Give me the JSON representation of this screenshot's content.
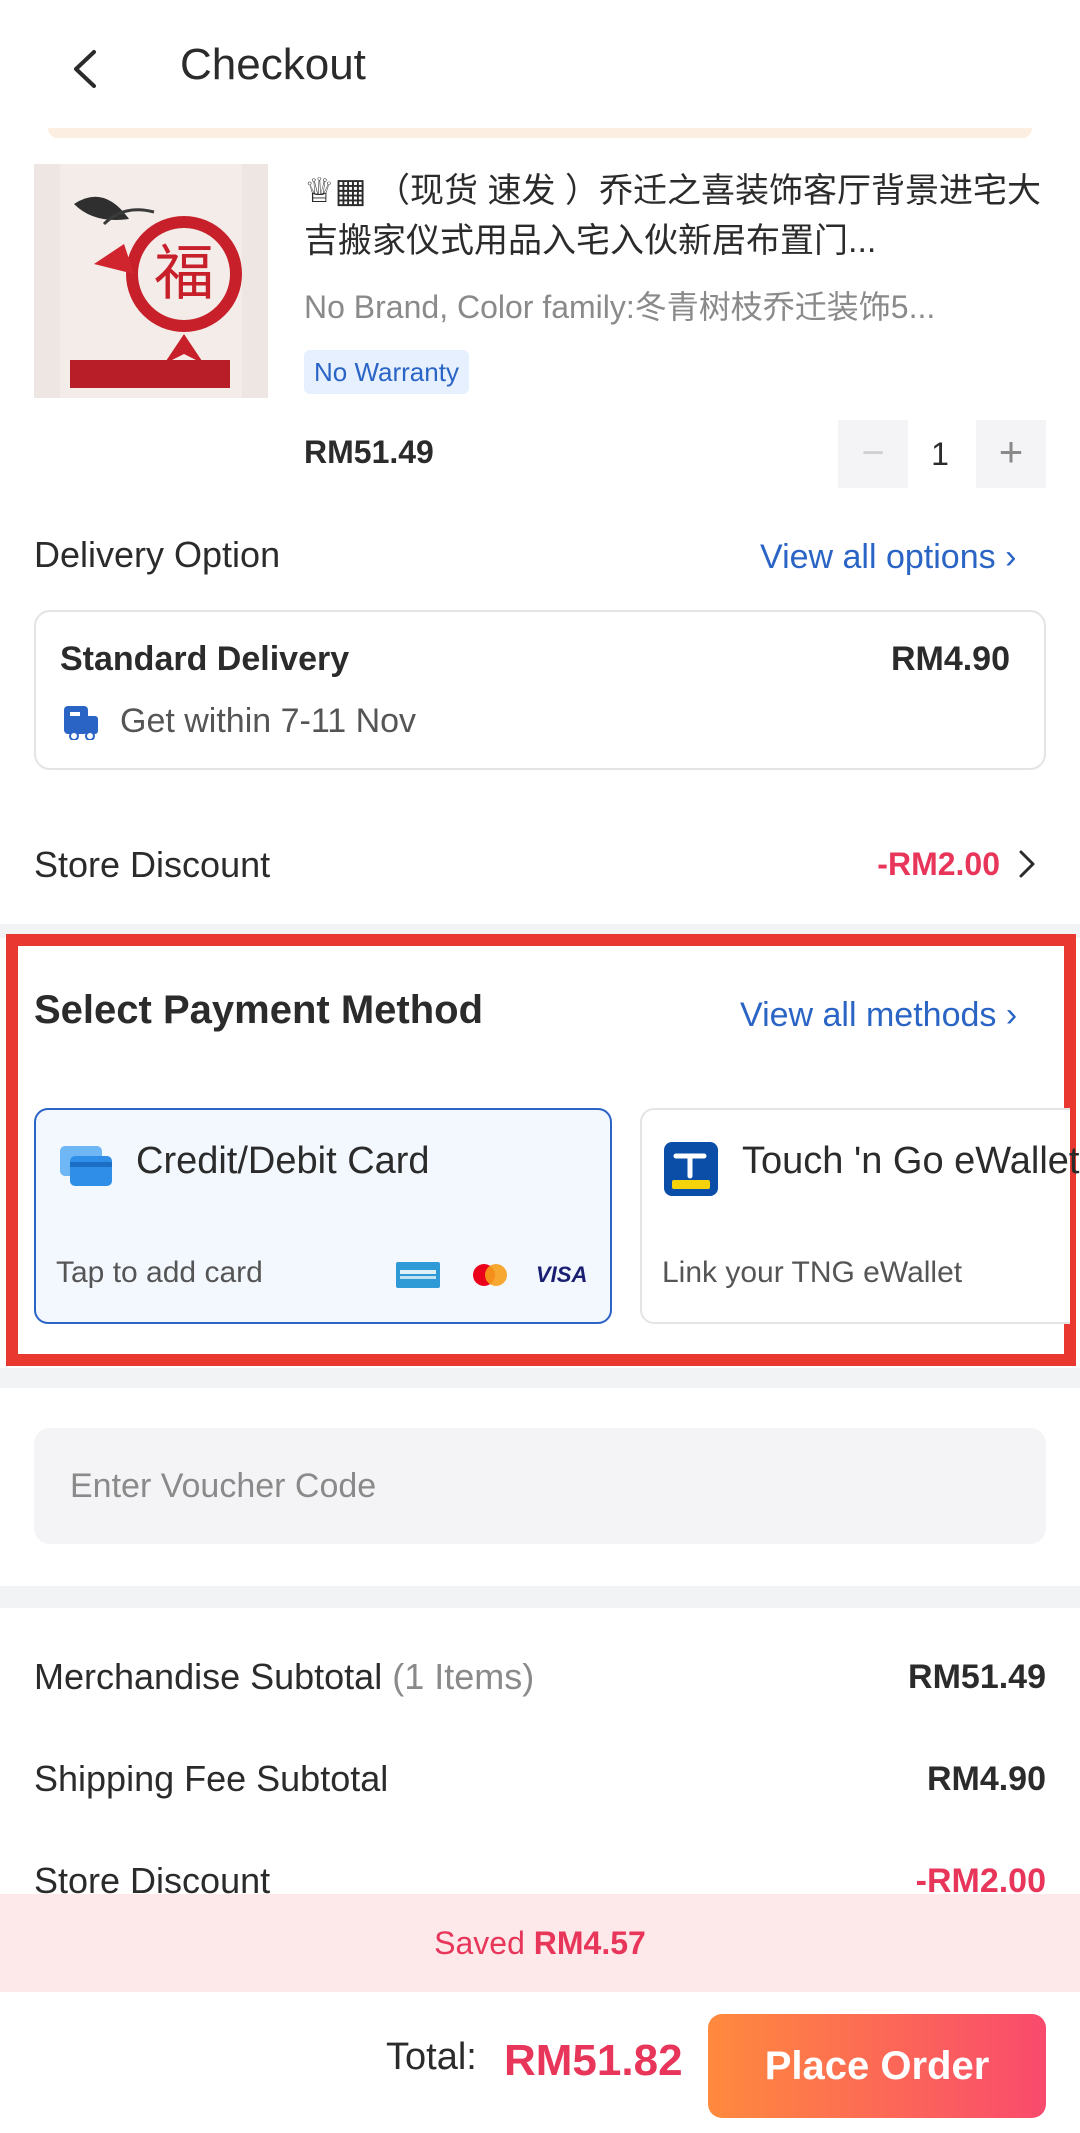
{
  "header": {
    "title": "Checkout"
  },
  "product": {
    "title": "♕▦ （现货 速发 ）乔迁之喜装饰客厅背景进宅大吉搬家仪式用品入宅入伙新居布置门...",
    "variant": "No Brand, Color family:冬青树枝乔迁装饰5...",
    "warranty": "No Warranty",
    "price": "RM51.49",
    "quantity": "1",
    "minus": "−",
    "plus": "+"
  },
  "delivery": {
    "label": "Delivery Option",
    "view_all": "View all options ›",
    "option_name": "Standard Delivery",
    "option_price": "RM4.90",
    "eta": "Get within 7-11 Nov"
  },
  "store_discount": {
    "label": "Store Discount",
    "value": "-RM2.00"
  },
  "payment": {
    "title": "Select Payment Method",
    "view_all": "View all methods ›",
    "methods": [
      {
        "name": "Credit/Debit Card",
        "sub": "Tap to add card",
        "card_brands": [
          "amex",
          "mastercard",
          "VISA"
        ]
      },
      {
        "name": "Touch 'n Go eWallet",
        "sub": "Link your TNG eWallet"
      }
    ]
  },
  "voucher": {
    "placeholder": "Enter Voucher Code"
  },
  "summary": {
    "rows": [
      {
        "label": "Merchandise Subtotal",
        "note": "(1 Items)",
        "value": "RM51.49"
      },
      {
        "label": "Shipping Fee Subtotal",
        "value": "RM4.90"
      },
      {
        "label": "Store Discount",
        "value": "-RM2.00"
      }
    ]
  },
  "saved": {
    "prefix": "Saved",
    "amount": "RM4.57"
  },
  "footer": {
    "total_label": "Total:",
    "total_value": "RM51.82",
    "cta": "Place Order"
  },
  "colors": {
    "accent_blue": "#2a64c5",
    "discount_red": "#e8365a",
    "highlight_red": "#e8382f",
    "cta_from": "#ff8a3d",
    "cta_to": "#f94a6d"
  },
  "icons": {
    "back": "back-arrow-icon",
    "truck": "delivery-truck-icon",
    "card": "credit-card-icon",
    "tng": "tng-ewallet-icon",
    "chevron": "chevron-right-icon"
  }
}
